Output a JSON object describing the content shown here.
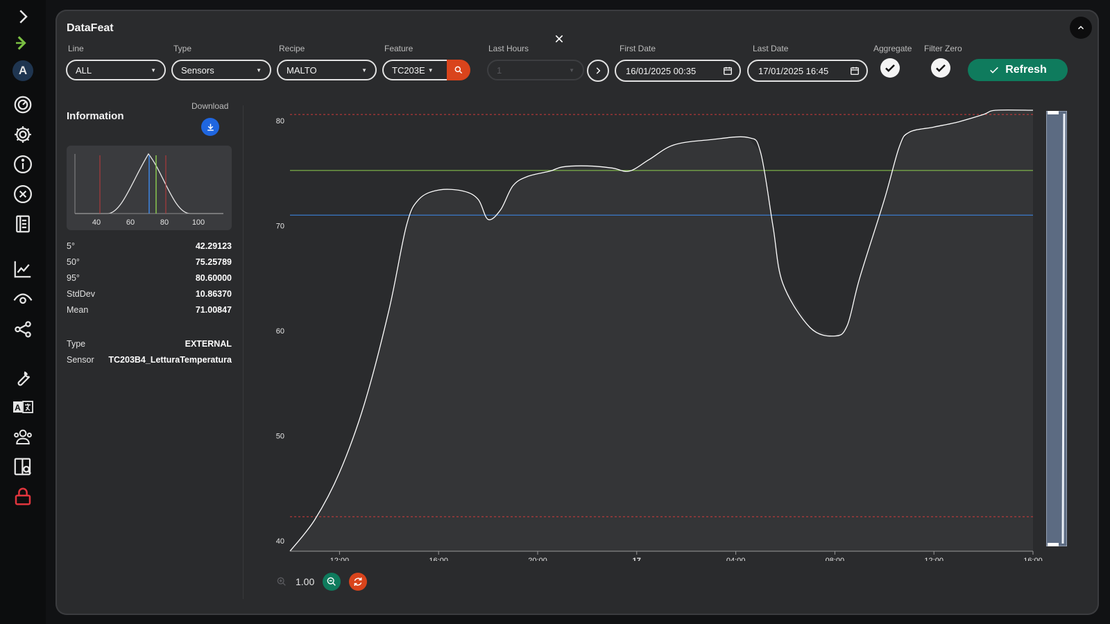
{
  "app": {
    "title": "DataFeat"
  },
  "sidebar": {
    "avatar_letter": "A",
    "items": [
      {
        "icon": "chevron-right-icon"
      },
      {
        "icon": "double-chevron-right-icon"
      },
      {
        "icon": "avatar"
      },
      {
        "icon": "gauge-icon"
      },
      {
        "icon": "gear-icon"
      },
      {
        "icon": "info-icon"
      },
      {
        "icon": "close-circle-icon"
      },
      {
        "icon": "notebook-icon"
      },
      {
        "icon": "line-chart-icon"
      },
      {
        "icon": "eye-icon"
      },
      {
        "icon": "share-nodes-icon"
      },
      {
        "icon": "wrench-icon"
      },
      {
        "icon": "translate-icon"
      },
      {
        "icon": "users-icon"
      },
      {
        "icon": "book-search-icon"
      },
      {
        "icon": "lock-icon"
      }
    ]
  },
  "filters": {
    "line": {
      "label": "Line",
      "value": "ALL"
    },
    "type": {
      "label": "Type",
      "value": "Sensors"
    },
    "recipe": {
      "label": "Recipe",
      "value": "MALTO"
    },
    "feature": {
      "label": "Feature",
      "value": "TC203E"
    },
    "last_hours": {
      "label": "Last Hours",
      "value": "1"
    },
    "first_date": {
      "label": "First Date",
      "value": "16/01/2025 00:35"
    },
    "last_date": {
      "label": "Last Date",
      "value": "17/01/2025 16:45"
    },
    "aggregate": {
      "label": "Aggregate",
      "checked": true
    },
    "filter_zero": {
      "label": "Filter Zero",
      "checked": true
    },
    "refresh_label": "Refresh"
  },
  "info": {
    "title": "Information",
    "download_label": "Download",
    "histogram_ticks": [
      "40",
      "60",
      "80",
      "100"
    ],
    "stats": [
      {
        "k": "5°",
        "v": "42.29123"
      },
      {
        "k": "50°",
        "v": "75.25789"
      },
      {
        "k": "95°",
        "v": "80.60000"
      },
      {
        "k": "StdDev",
        "v": "10.86370"
      },
      {
        "k": "Mean",
        "v": "71.00847"
      }
    ],
    "details": [
      {
        "k": "Type",
        "v": "EXTERNAL"
      },
      {
        "k": "Sensor",
        "v": "TC203B4_LetturaTemperatura"
      }
    ]
  },
  "zoom": {
    "value": "1.00"
  },
  "colors": {
    "accent_green": "#0f7b5d",
    "accent_orange": "#d9441c",
    "download_blue": "#1f66e0",
    "series_line": "#ffffff",
    "threshold_red": "#d23b3b",
    "median_green": "#8fd14f",
    "mean_blue": "#3d8cf0"
  },
  "chart_data": {
    "type": "area",
    "title": "",
    "xlabel": "",
    "ylabel": "",
    "ylim": [
      39,
      81
    ],
    "yticks": [
      40,
      50,
      60,
      70,
      80
    ],
    "xticks": [
      "12:00",
      "16:00",
      "20:00",
      "17",
      "04:00",
      "08:00",
      "12:00",
      "16:00"
    ],
    "x_hours_from_first": [
      10,
      14,
      18,
      22,
      26,
      30,
      34,
      38
    ],
    "reference_lines": [
      {
        "label": "95°",
        "value": 80.6,
        "color": "#d23b3b",
        "style": "dashed"
      },
      {
        "label": "50°",
        "value": 75.26,
        "color": "#8fd14f",
        "style": "solid"
      },
      {
        "label": "Mean",
        "value": 71.01,
        "color": "#3d8cf0",
        "style": "solid"
      },
      {
        "label": "5°",
        "value": 42.29,
        "color": "#d23b3b",
        "style": "dashed"
      }
    ],
    "series": [
      {
        "values": [
          [
            8.0,
            39.0
          ],
          [
            9.0,
            42.0
          ],
          [
            10.0,
            46.5
          ],
          [
            11.0,
            53.0
          ],
          [
            12.0,
            62.0
          ],
          [
            12.7,
            70.0
          ],
          [
            13.2,
            72.5
          ],
          [
            14.0,
            73.4
          ],
          [
            15.0,
            73.3
          ],
          [
            15.6,
            72.5
          ],
          [
            16.0,
            70.6
          ],
          [
            16.5,
            71.5
          ],
          [
            17.0,
            73.8
          ],
          [
            17.6,
            74.7
          ],
          [
            18.5,
            75.2
          ],
          [
            19.0,
            75.6
          ],
          [
            20.0,
            75.7
          ],
          [
            21.0,
            75.5
          ],
          [
            21.7,
            75.2
          ],
          [
            22.5,
            76.3
          ],
          [
            23.5,
            77.7
          ],
          [
            25.0,
            78.2
          ],
          [
            26.5,
            78.4
          ],
          [
            27.0,
            77.0
          ],
          [
            27.5,
            70.0
          ],
          [
            27.9,
            64.5
          ],
          [
            29.0,
            60.3
          ],
          [
            30.0,
            59.5
          ],
          [
            30.5,
            60.5
          ],
          [
            31.0,
            65.0
          ],
          [
            32.0,
            72.5
          ],
          [
            32.6,
            77.5
          ],
          [
            33.0,
            78.9
          ],
          [
            34.0,
            79.4
          ],
          [
            35.0,
            79.9
          ],
          [
            36.0,
            80.6
          ],
          [
            36.5,
            81.0
          ],
          [
            38.0,
            81.0
          ]
        ]
      }
    ]
  }
}
